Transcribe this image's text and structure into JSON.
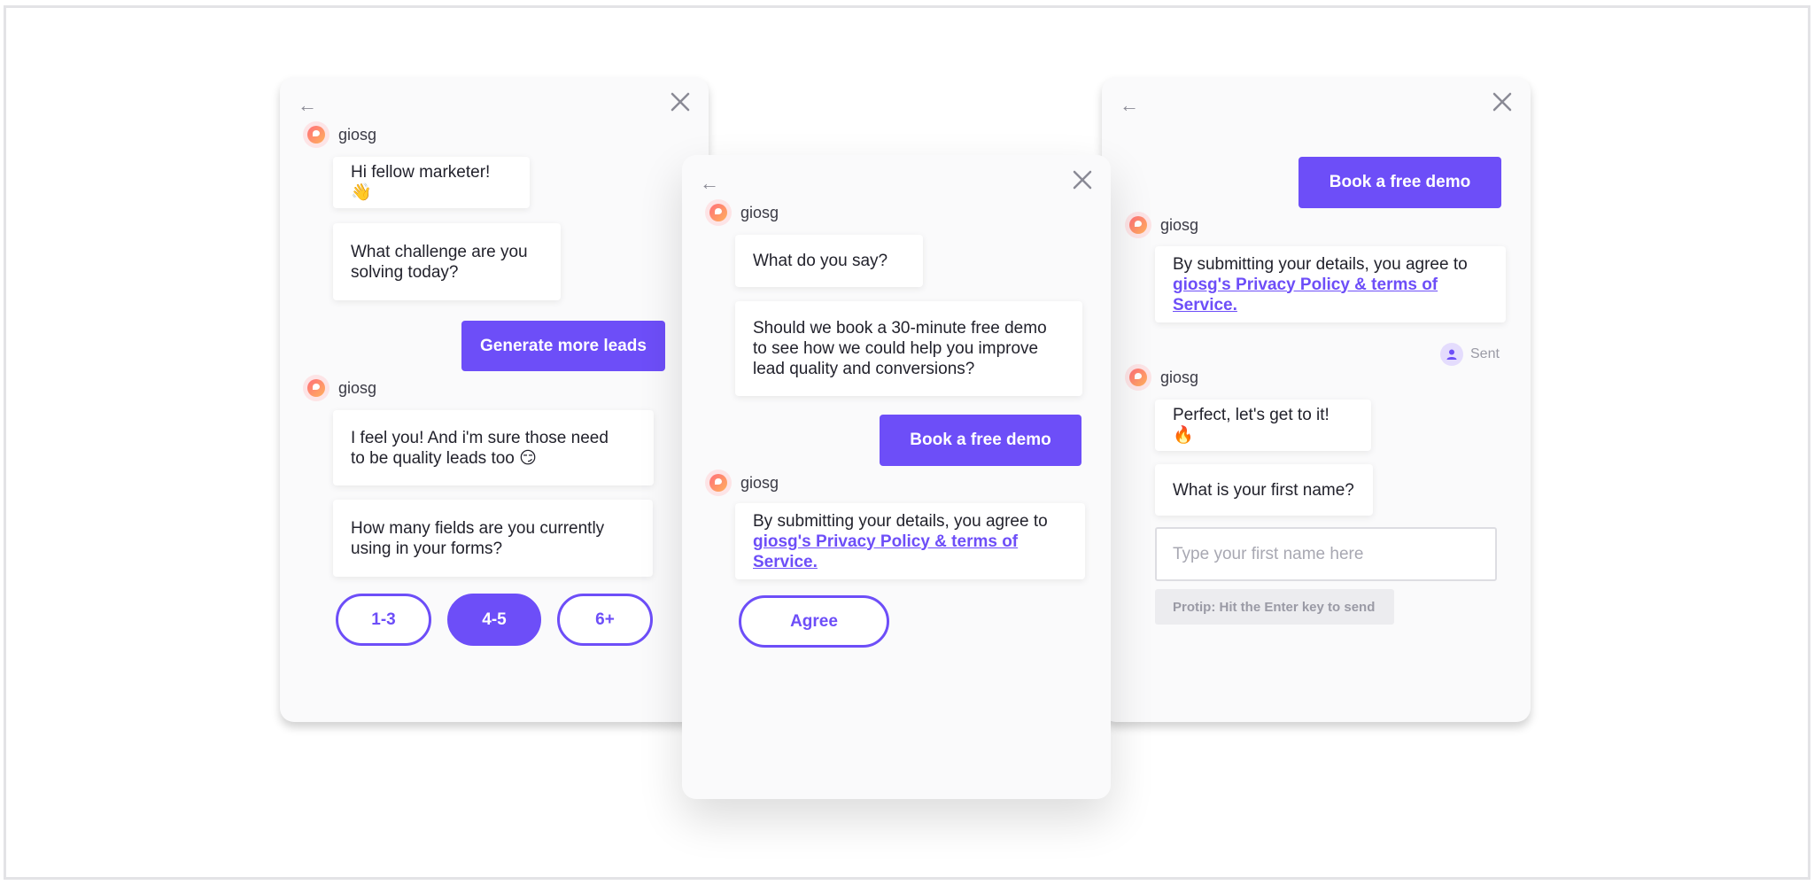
{
  "bot_name": "giosg",
  "left_panel": {
    "back": "←",
    "msg1": "Hi fellow marketer! 👋",
    "msg2_line1": "What challenge are you",
    "msg2_line2": "solving today?",
    "reply": "Generate more leads",
    "msg3_line1": "I feel you! And i'm sure those need",
    "msg3_line2": "to be quality leads too 😏",
    "msg4_line1": "How many fields are you currently",
    "msg4_line2": "using in your forms?",
    "options": [
      "1-3",
      "4-5",
      "6+"
    ],
    "selected_option": "4-5"
  },
  "middle_panel": {
    "back": "←",
    "msg1": "What do you say?",
    "msg2_line1": "Should we book a 30-minute free demo",
    "msg2_line2": "to see how we could help you improve",
    "msg2_line3": "lead quality and conversions?",
    "reply": "Book a free demo",
    "consent_text": "By submitting your details, you agree to",
    "consent_link": "giosg's Privacy Policy & terms of Service.",
    "agree": "Agree"
  },
  "right_panel": {
    "back": "←",
    "reply": "Book a free demo",
    "consent_text": "By submitting your details, you agree to",
    "consent_link": "giosg's Privacy Policy & terms of Service.",
    "sent_label": "Sent",
    "msg1": "Perfect, let's get to it! 🔥",
    "msg2": "What is your first name?",
    "input_placeholder": "Type your first name here",
    "protip": "Protip: Hit the Enter key to send"
  },
  "colors": {
    "accent": "#6d4ef8",
    "panel_bg": "#fafafb"
  }
}
